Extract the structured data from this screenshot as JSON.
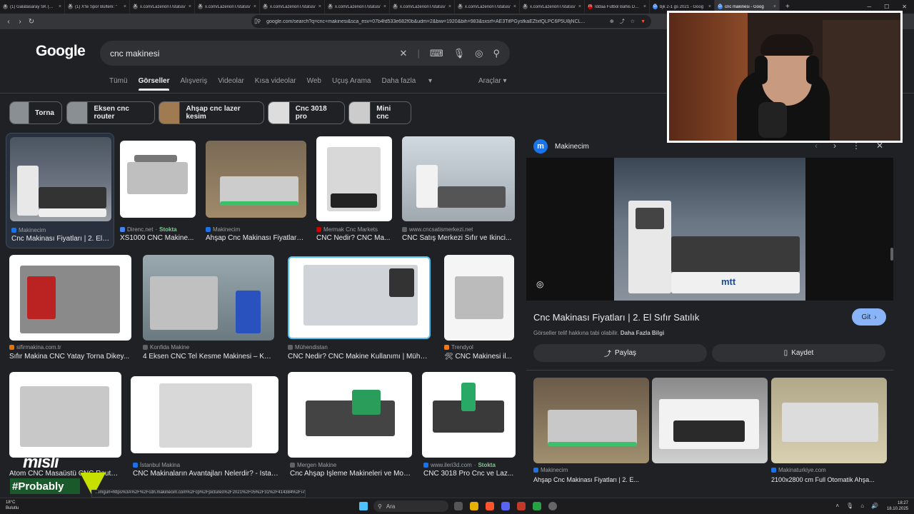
{
  "browser": {
    "tabs": [
      {
        "title": "(1) Galatasaray SK (@Ga",
        "fav": "x",
        "color": "#555"
      },
      {
        "title": "(1) X'te Spor Bülteni: \"",
        "fav": "X",
        "color": "#555"
      },
      {
        "title": "x.com/LazerionT/status/",
        "fav": "X",
        "color": "#555"
      },
      {
        "title": "x.com/LazerionT/status/",
        "fav": "X",
        "color": "#555"
      },
      {
        "title": "x.com/LazerionT/status/",
        "fav": "X",
        "color": "#555"
      },
      {
        "title": "x.com/LazerionT/status/",
        "fav": "X",
        "color": "#555"
      },
      {
        "title": "x.com/LazerionT/status/",
        "fav": "X",
        "color": "#555"
      },
      {
        "title": "x.com/LazerionT/status/",
        "fav": "X",
        "color": "#555"
      },
      {
        "title": "x.com/LazerionT/status/",
        "fav": "X",
        "color": "#555"
      },
      {
        "title": "İddaa Futbol Bahis Detay",
        "fav": "m",
        "color": "#c00"
      },
      {
        "title": "bjk 2-1 gs 2021 - Goog",
        "fav": "G",
        "color": "#4285f4"
      },
      {
        "title": "cnc makinesi - Goog",
        "fav": "G",
        "color": "#4285f4",
        "active": true
      }
    ],
    "new_tab": "+",
    "url": "google.com/search?q=cnc+makinesi&sca_esv=07b4fd533e682f0b&udm=2&biw=1920&bih=983&sxsrf=AE3TifPGysfkaEZtxfQLPC6P5U8jNCL..."
  },
  "google": {
    "logo": "Google",
    "query": "cnc makinesi",
    "tabs": [
      "Tümü",
      "Görseller",
      "Alışveriş",
      "Videolar",
      "Kısa videolar",
      "Web",
      "Uçuş Arama",
      "Daha fazla"
    ],
    "active_tab": "Görseller",
    "tools": "Araçlar",
    "chips": [
      "Torna",
      "Eksen cnc router",
      "Ahşap cnc lazer kesim",
      "Cnc 3018 pro",
      "Mini cnc"
    ]
  },
  "results": [
    {
      "source": "Makinecim",
      "title": "Cnc Makinası Fiyatları | 2. El Sıfır Satılık",
      "stock": ""
    },
    {
      "source": "Direnc.net",
      "title": "XS1000 CNC Makine...",
      "stock": "Stokta"
    },
    {
      "source": "Makinecim",
      "title": "Ahşap Cnc Makinası Fiyatları | 2...",
      "stock": ""
    },
    {
      "source": "Mermak Cnc Markets",
      "title": "CNC Nedir? CNC Ma...",
      "stock": ""
    },
    {
      "source": "www.cncsatismerkezi.net",
      "title": "CNC Satış Merkezi Sıfır ve İkinci...",
      "stock": ""
    },
    {
      "source": "sifirmakina.com.tr",
      "title": "Sıfır Makina CNC Yatay Torna Dikey...",
      "stock": ""
    },
    {
      "source": "Konfida Makine",
      "title": "4 Eksen CNC Tel Kesme Makinesi – Kon...",
      "stock": ""
    },
    {
      "source": "Mühendistan",
      "title": "CNC Nedir? CNC Makine Kullanımı | Mühen...",
      "stock": ""
    },
    {
      "source": "Trendyol",
      "title": "🛠 CNC Makinesi il...",
      "stock": ""
    },
    {
      "source": "",
      "title": "Atom CNC Masaüstü CNC Route...",
      "stock": ""
    },
    {
      "source": "İstanbul Makina",
      "title": "CNC Makinaların Avantajları Nelerdir? - İstan...",
      "stock": ""
    },
    {
      "source": "Mergen Makine",
      "title": "Cnc Ahşap İşleme Makineleri ve Mod...",
      "stock": ""
    },
    {
      "source": "www.ileri3d.com",
      "title": "CNC 3018 Pro Cnc ve Laz...",
      "stock": "Stokta"
    }
  ],
  "panel": {
    "site": "Makinecim",
    "site_initial": "m",
    "title": "Cnc Makinası Fiyatları | 2. El Sıfır Satılık",
    "visit": "Git",
    "note": "Görseller telif hakkına tabi olabilir.",
    "note_link": "Daha Fazla Bilgi",
    "share": "Paylaş",
    "save": "Kaydet",
    "brand": "mtt",
    "related": [
      {
        "source": "Makinecim",
        "title": "Ahşap Cnc Makinası Fiyatları | 2. E..."
      },
      {
        "source": "",
        "title": ""
      },
      {
        "source": "Makinaturkiye.com",
        "title": "2100x2800 cm Full Otomatik Ahşa..."
      }
    ]
  },
  "overlay": {
    "brand": "misli",
    "tag": "#Probably",
    "status_url": "...imgurl=https%3A%2F%2Fcdn.makinecim.com%2Fcp%2Fpictures%2F2021%2F05%2F31%2F414384%2Fi-m..."
  },
  "taskbar": {
    "temp": "18°C",
    "weather": "Bulutlu",
    "search": "Ara",
    "time": "18:27",
    "date": "18.10.2025"
  }
}
